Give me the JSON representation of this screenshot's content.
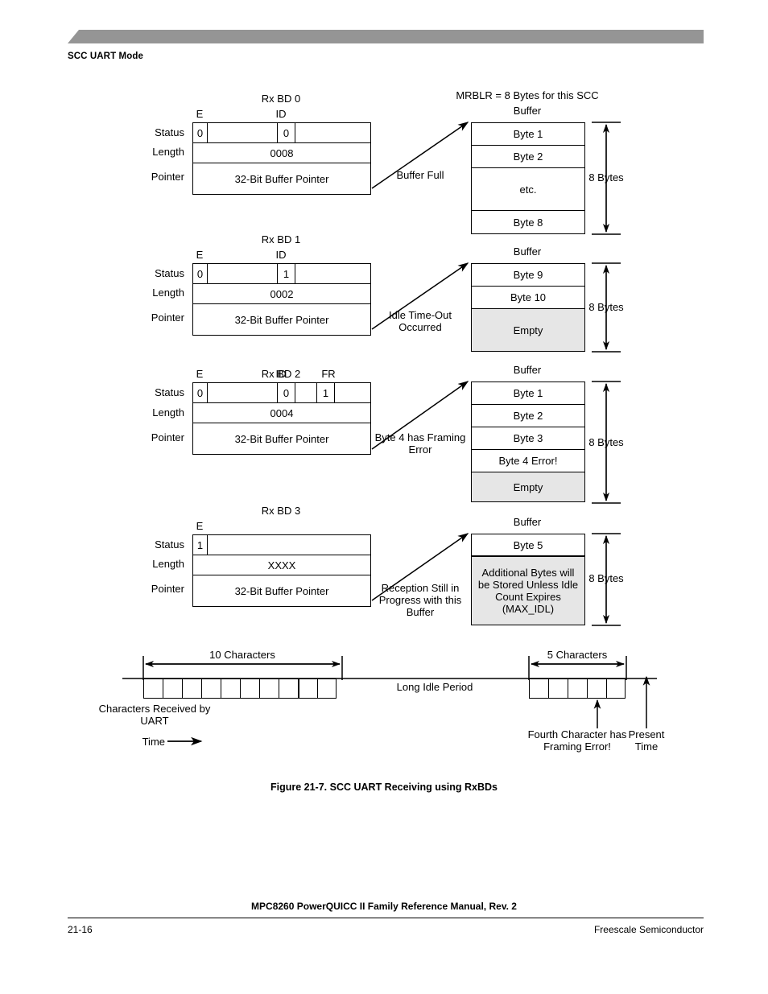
{
  "header": {
    "section_title": "SCC UART Mode",
    "bar_color": "#959595"
  },
  "figure": {
    "caption": "Figure 21-7. SCC UART Receiving using RxBDs",
    "mrblr_note": "MRBLR = 8 Bytes for this SCC",
    "row_labels": {
      "status": "Status",
      "length": "Length",
      "pointer": "Pointer"
    },
    "buffer_label": "Buffer",
    "size_label": "8 Bytes",
    "pointer_text": "32-Bit Buffer Pointer",
    "bds": [
      {
        "title": "Rx BD 0",
        "bit_labels": {
          "e": "E",
          "id": "ID",
          "fr": ""
        },
        "status_bits": {
          "e": "0",
          "id": "0",
          "fr": ""
        },
        "length": "0008",
        "pointer": "32-Bit Buffer Pointer",
        "arrow_label": "Buffer Full",
        "buffer_rows": [
          {
            "text": "Byte 1",
            "gray": false
          },
          {
            "text": "Byte 2",
            "gray": false
          },
          {
            "text": "etc.",
            "gray": false
          },
          {
            "text": "Byte 8",
            "gray": false
          }
        ]
      },
      {
        "title": "Rx BD 1",
        "bit_labels": {
          "e": "E",
          "id": "ID",
          "fr": ""
        },
        "status_bits": {
          "e": "0",
          "id": "1",
          "fr": ""
        },
        "length": "0002",
        "pointer": "32-Bit Buffer Pointer",
        "arrow_label": "Idle Time-Out Occurred",
        "buffer_rows": [
          {
            "text": "Byte 9",
            "gray": false
          },
          {
            "text": "Byte 10",
            "gray": false
          },
          {
            "text": "Empty",
            "gray": true
          }
        ]
      },
      {
        "title": "Rx BD 2",
        "bit_labels": {
          "e": "E",
          "id": "ID",
          "fr": "FR"
        },
        "status_bits": {
          "e": "0",
          "id": "0",
          "fr": "1"
        },
        "length": "0004",
        "pointer": "32-Bit Buffer Pointer",
        "arrow_label": "Byte 4 has Framing Error",
        "buffer_rows": [
          {
            "text": "Byte 1",
            "gray": false
          },
          {
            "text": "Byte 2",
            "gray": false
          },
          {
            "text": "Byte 3",
            "gray": false
          },
          {
            "text": "Byte 4 Error!",
            "gray": false
          },
          {
            "text": "Empty",
            "gray": true
          }
        ]
      },
      {
        "title": "Rx BD 3",
        "bit_labels": {
          "e": "E",
          "id": "",
          "fr": ""
        },
        "status_bits": {
          "e": "1",
          "id": "",
          "fr": ""
        },
        "length": "XXXX",
        "pointer": "32-Bit Buffer Pointer",
        "arrow_label": "Reception Still in Progress with this Buffer",
        "buffer_rows": [
          {
            "text": "Byte 5",
            "gray": false
          },
          {
            "text": "Additional Bytes will be Stored Unless Idle Count Expires (MAX_IDL)",
            "gray": true
          }
        ]
      }
    ],
    "timeline": {
      "left_span_label": "10 Characters",
      "right_span_label": "5 Characters",
      "idle_label": "Long Idle Period",
      "left_caption": "Characters Received by UART",
      "time_label": "Time",
      "error_label": "Fourth Character has Framing Error!",
      "present_time_label": "Present Time",
      "left_char_count": 10,
      "right_char_count": 5,
      "error_char_index": 4
    }
  },
  "footer": {
    "manual_title": "MPC8260 PowerQUICC II Family Reference Manual, Rev. 2",
    "page_number": "21-16",
    "publisher": "Freescale Semiconductor"
  }
}
